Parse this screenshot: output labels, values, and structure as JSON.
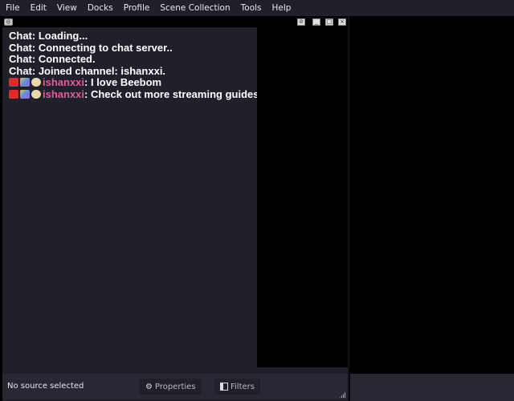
{
  "menu": [
    "File",
    "Edit",
    "View",
    "Docks",
    "Profile",
    "Scene Collection",
    "Tools",
    "Help"
  ],
  "chat": {
    "system": [
      "Chat: Loading...",
      "Chat: Connecting to chat server..",
      "Chat: Connected.",
      "Chat: Joined channel: ishanxxi."
    ],
    "messages": [
      {
        "user": "ishanxxi",
        "text": ": I love Beebom"
      },
      {
        "user": "ishanxxi",
        "text": ": Check out more streaming guides"
      }
    ]
  },
  "status": {
    "no_source": "No source selected",
    "properties": "Properties",
    "filters": "Filters"
  },
  "colors": {
    "username": "#e45ca0",
    "chat_bg": "#1f2029"
  }
}
